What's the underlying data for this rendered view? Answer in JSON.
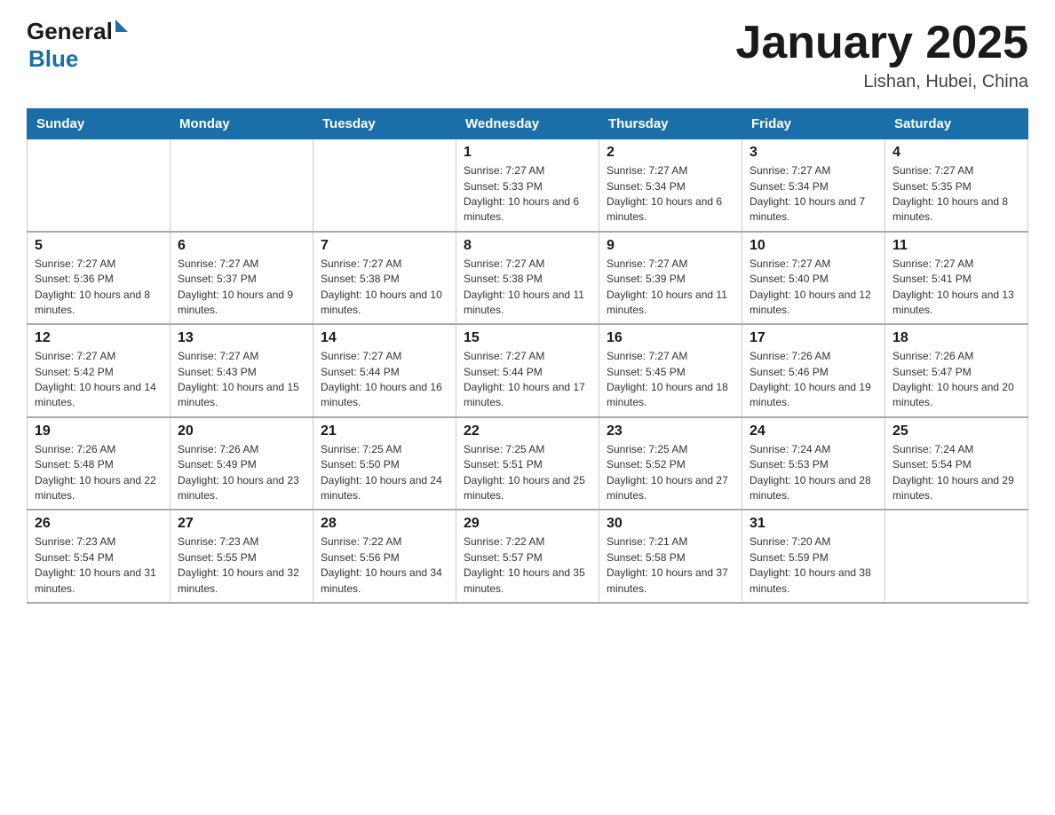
{
  "header": {
    "logo_general": "General",
    "logo_blue": "Blue",
    "title": "January 2025",
    "subtitle": "Lishan, Hubei, China"
  },
  "weekdays": [
    "Sunday",
    "Monday",
    "Tuesday",
    "Wednesday",
    "Thursday",
    "Friday",
    "Saturday"
  ],
  "weeks": [
    [
      {
        "day": "",
        "info": ""
      },
      {
        "day": "",
        "info": ""
      },
      {
        "day": "",
        "info": ""
      },
      {
        "day": "1",
        "info": "Sunrise: 7:27 AM\nSunset: 5:33 PM\nDaylight: 10 hours and 6 minutes."
      },
      {
        "day": "2",
        "info": "Sunrise: 7:27 AM\nSunset: 5:34 PM\nDaylight: 10 hours and 6 minutes."
      },
      {
        "day": "3",
        "info": "Sunrise: 7:27 AM\nSunset: 5:34 PM\nDaylight: 10 hours and 7 minutes."
      },
      {
        "day": "4",
        "info": "Sunrise: 7:27 AM\nSunset: 5:35 PM\nDaylight: 10 hours and 8 minutes."
      }
    ],
    [
      {
        "day": "5",
        "info": "Sunrise: 7:27 AM\nSunset: 5:36 PM\nDaylight: 10 hours and 8 minutes."
      },
      {
        "day": "6",
        "info": "Sunrise: 7:27 AM\nSunset: 5:37 PM\nDaylight: 10 hours and 9 minutes."
      },
      {
        "day": "7",
        "info": "Sunrise: 7:27 AM\nSunset: 5:38 PM\nDaylight: 10 hours and 10 minutes."
      },
      {
        "day": "8",
        "info": "Sunrise: 7:27 AM\nSunset: 5:38 PM\nDaylight: 10 hours and 11 minutes."
      },
      {
        "day": "9",
        "info": "Sunrise: 7:27 AM\nSunset: 5:39 PM\nDaylight: 10 hours and 11 minutes."
      },
      {
        "day": "10",
        "info": "Sunrise: 7:27 AM\nSunset: 5:40 PM\nDaylight: 10 hours and 12 minutes."
      },
      {
        "day": "11",
        "info": "Sunrise: 7:27 AM\nSunset: 5:41 PM\nDaylight: 10 hours and 13 minutes."
      }
    ],
    [
      {
        "day": "12",
        "info": "Sunrise: 7:27 AM\nSunset: 5:42 PM\nDaylight: 10 hours and 14 minutes."
      },
      {
        "day": "13",
        "info": "Sunrise: 7:27 AM\nSunset: 5:43 PM\nDaylight: 10 hours and 15 minutes."
      },
      {
        "day": "14",
        "info": "Sunrise: 7:27 AM\nSunset: 5:44 PM\nDaylight: 10 hours and 16 minutes."
      },
      {
        "day": "15",
        "info": "Sunrise: 7:27 AM\nSunset: 5:44 PM\nDaylight: 10 hours and 17 minutes."
      },
      {
        "day": "16",
        "info": "Sunrise: 7:27 AM\nSunset: 5:45 PM\nDaylight: 10 hours and 18 minutes."
      },
      {
        "day": "17",
        "info": "Sunrise: 7:26 AM\nSunset: 5:46 PM\nDaylight: 10 hours and 19 minutes."
      },
      {
        "day": "18",
        "info": "Sunrise: 7:26 AM\nSunset: 5:47 PM\nDaylight: 10 hours and 20 minutes."
      }
    ],
    [
      {
        "day": "19",
        "info": "Sunrise: 7:26 AM\nSunset: 5:48 PM\nDaylight: 10 hours and 22 minutes."
      },
      {
        "day": "20",
        "info": "Sunrise: 7:26 AM\nSunset: 5:49 PM\nDaylight: 10 hours and 23 minutes."
      },
      {
        "day": "21",
        "info": "Sunrise: 7:25 AM\nSunset: 5:50 PM\nDaylight: 10 hours and 24 minutes."
      },
      {
        "day": "22",
        "info": "Sunrise: 7:25 AM\nSunset: 5:51 PM\nDaylight: 10 hours and 25 minutes."
      },
      {
        "day": "23",
        "info": "Sunrise: 7:25 AM\nSunset: 5:52 PM\nDaylight: 10 hours and 27 minutes."
      },
      {
        "day": "24",
        "info": "Sunrise: 7:24 AM\nSunset: 5:53 PM\nDaylight: 10 hours and 28 minutes."
      },
      {
        "day": "25",
        "info": "Sunrise: 7:24 AM\nSunset: 5:54 PM\nDaylight: 10 hours and 29 minutes."
      }
    ],
    [
      {
        "day": "26",
        "info": "Sunrise: 7:23 AM\nSunset: 5:54 PM\nDaylight: 10 hours and 31 minutes."
      },
      {
        "day": "27",
        "info": "Sunrise: 7:23 AM\nSunset: 5:55 PM\nDaylight: 10 hours and 32 minutes."
      },
      {
        "day": "28",
        "info": "Sunrise: 7:22 AM\nSunset: 5:56 PM\nDaylight: 10 hours and 34 minutes."
      },
      {
        "day": "29",
        "info": "Sunrise: 7:22 AM\nSunset: 5:57 PM\nDaylight: 10 hours and 35 minutes."
      },
      {
        "day": "30",
        "info": "Sunrise: 7:21 AM\nSunset: 5:58 PM\nDaylight: 10 hours and 37 minutes."
      },
      {
        "day": "31",
        "info": "Sunrise: 7:20 AM\nSunset: 5:59 PM\nDaylight: 10 hours and 38 minutes."
      },
      {
        "day": "",
        "info": ""
      }
    ]
  ]
}
